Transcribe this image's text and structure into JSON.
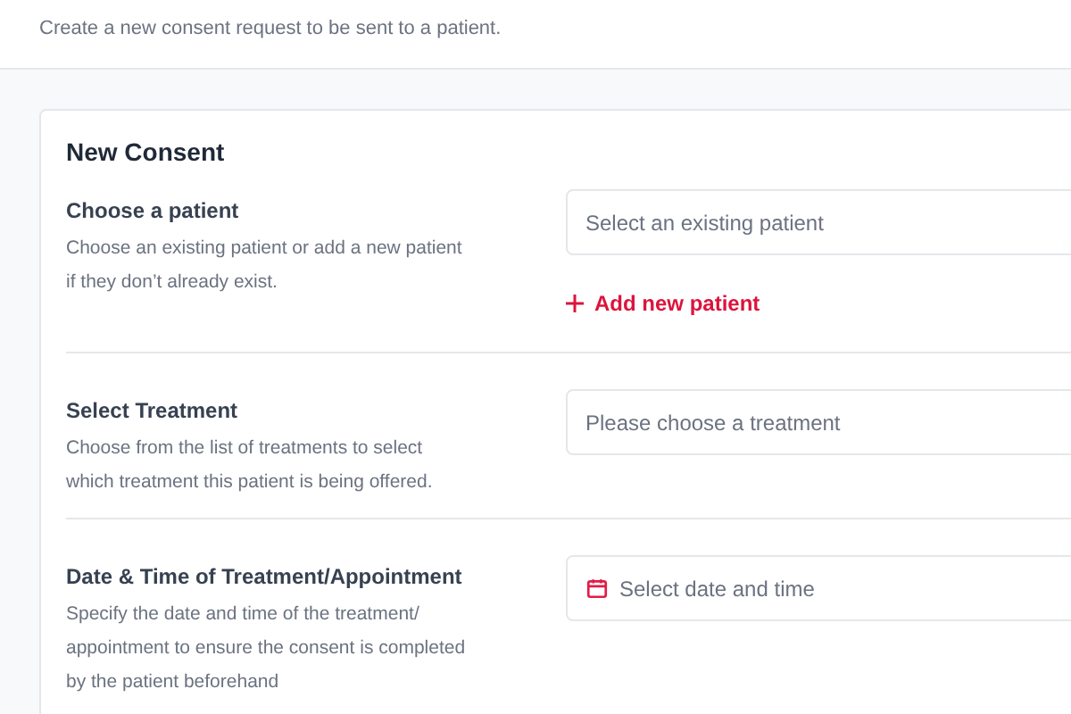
{
  "header": {
    "subtitle": "Create a new consent request to be sent to a patient."
  },
  "card": {
    "title": "New Consent",
    "sections": [
      {
        "label": "Choose a patient",
        "description": "Choose an existing patient or add a new patient if they don’t already exist.",
        "field": {
          "kind": "select",
          "placeholder": "Select an existing patient"
        },
        "action": "Add new patient"
      },
      {
        "label": "Select Treatment",
        "description": "Choose from the list of treatments to select which treatment this patient is being offered.",
        "field": {
          "kind": "select",
          "placeholder": "Please choose a treatment"
        }
      },
      {
        "label": "Date & Time of Treatment/Appointment",
        "description": "Specify the date and time of the treatment/ appointment to ensure the consent is completed by the patient beforehand",
        "field": {
          "kind": "date",
          "placeholder": "Select date and time"
        }
      }
    ]
  }
}
